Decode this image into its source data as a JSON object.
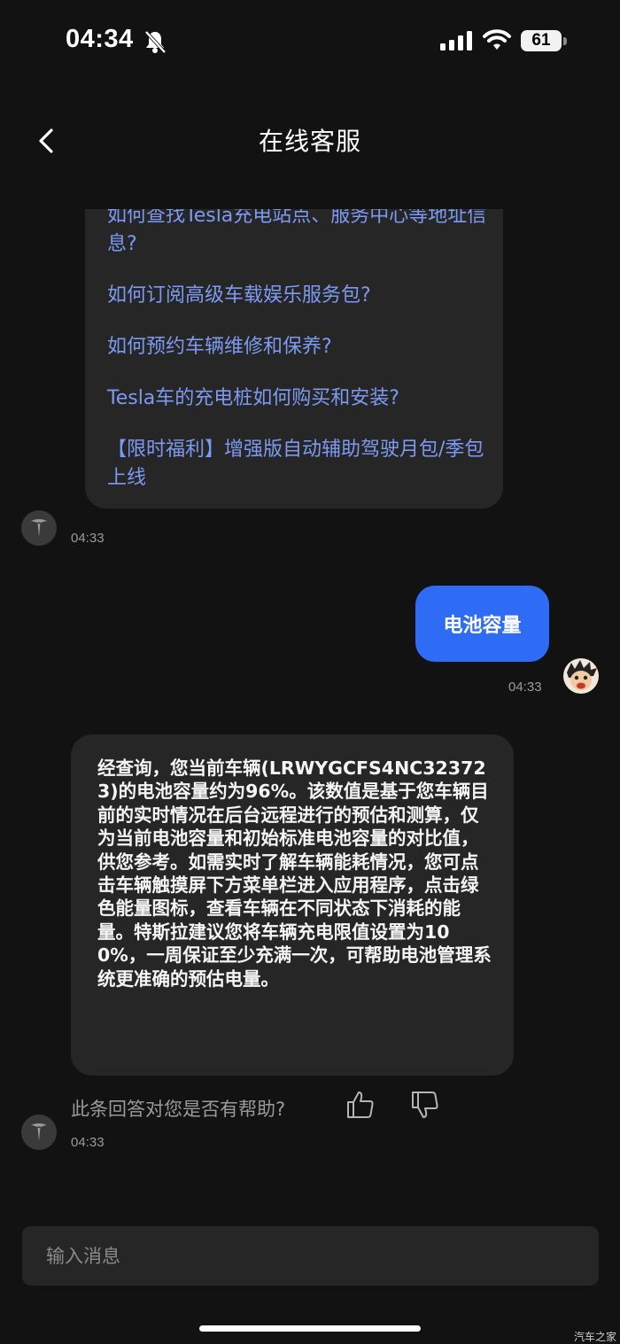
{
  "status_bar": {
    "time": "04:34",
    "battery": "61",
    "icons": [
      "bell-slash-icon",
      "signal-icon",
      "wifi-icon",
      "battery-icon"
    ]
  },
  "header": {
    "title": "在线客服",
    "back_icon": "chevron-left-icon"
  },
  "faq": {
    "items": [
      "如何查找Tesla充电站点、服务中心等地址信息?",
      "如何订阅高级车载娱乐服务包?",
      "如何预约车辆维修和保养?",
      "Tesla车的充电桩如何购买和安装?",
      "【限时福利】增强版自动辅助驾驶月包/季包上线"
    ],
    "timestamp": "04:33"
  },
  "user_message": {
    "text": "电池容量",
    "timestamp": "04:33"
  },
  "bot_answer": {
    "text": "经查询，您当前车辆(LRWYGCFS4NC323723)的电池容量约为96%。该数值是基于您车辆目前的实时情况在后台远程进行的预估和测算，仅为当前电池容量和初始标准电池容量的对比值，供您参考。如需实时了解车辆能耗情况，您可点击车辆触摸屏下方菜单栏进入应用程序，点击绿色能量图标，查看车辆在不同状态下消耗的能量。特斯拉建议您将车辆充电限值设置为100%，一周保证至少充满一次，可帮助电池管理系统更准确的预估电量。",
    "feedback_prompt": "此条回答对您是否有帮助?",
    "timestamp": "04:33"
  },
  "input": {
    "placeholder": "输入消息"
  },
  "watermark": "汽车之家",
  "colors": {
    "background": "#121212",
    "bubble": "#262626",
    "user_bubble": "#2f6cf6",
    "link": "#7d9af2",
    "muted": "#9a9a9a"
  }
}
